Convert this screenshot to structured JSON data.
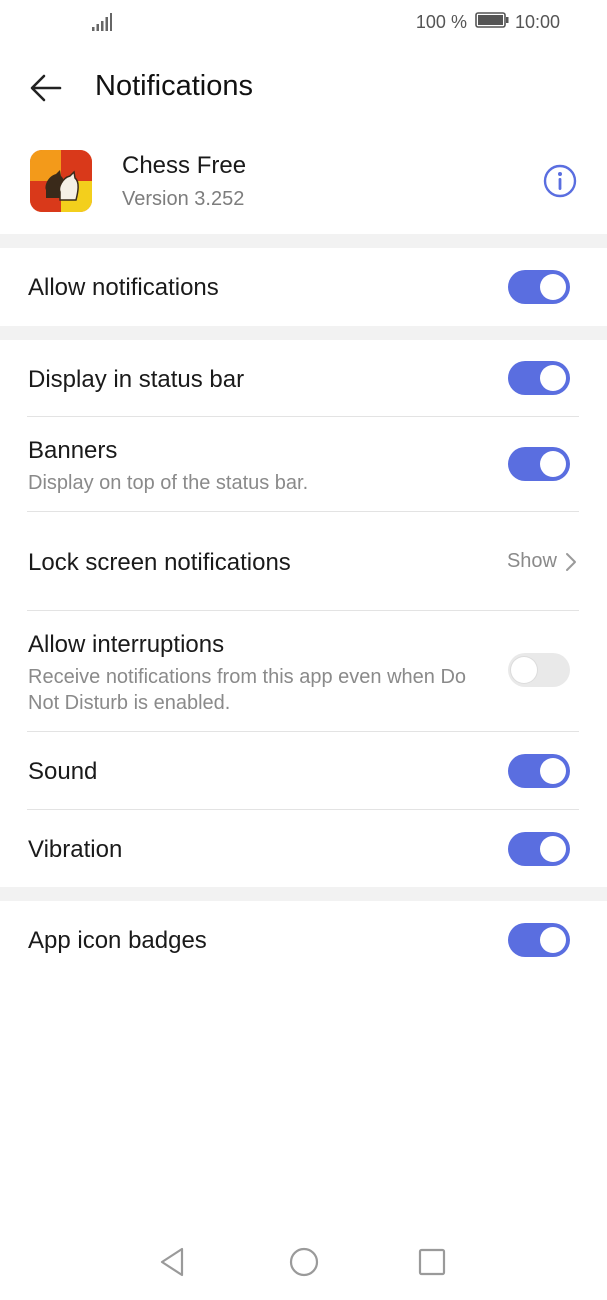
{
  "status_bar": {
    "battery": "100 %",
    "time": "10:00"
  },
  "header": {
    "title": "Notifications"
  },
  "app": {
    "name": "Chess Free",
    "version": "Version 3.252"
  },
  "settings": {
    "allow_notifications": {
      "label": "Allow notifications",
      "on": true
    },
    "display_status_bar": {
      "label": "Display in status bar",
      "on": true
    },
    "banners": {
      "label": "Banners",
      "sub": "Display on top of the status bar.",
      "on": true
    },
    "lock_screen": {
      "label": "Lock screen notifications",
      "value": "Show"
    },
    "interruptions": {
      "label": "Allow interruptions",
      "sub": "Receive notifications from this app even when Do Not Disturb is enabled.",
      "on": false
    },
    "sound": {
      "label": "Sound",
      "on": true
    },
    "vibration": {
      "label": "Vibration",
      "on": true
    },
    "badges": {
      "label": "App icon badges",
      "on": true
    }
  },
  "colors": {
    "accent": "#5a6ee0",
    "toggle_off": "#e9e9e9"
  }
}
